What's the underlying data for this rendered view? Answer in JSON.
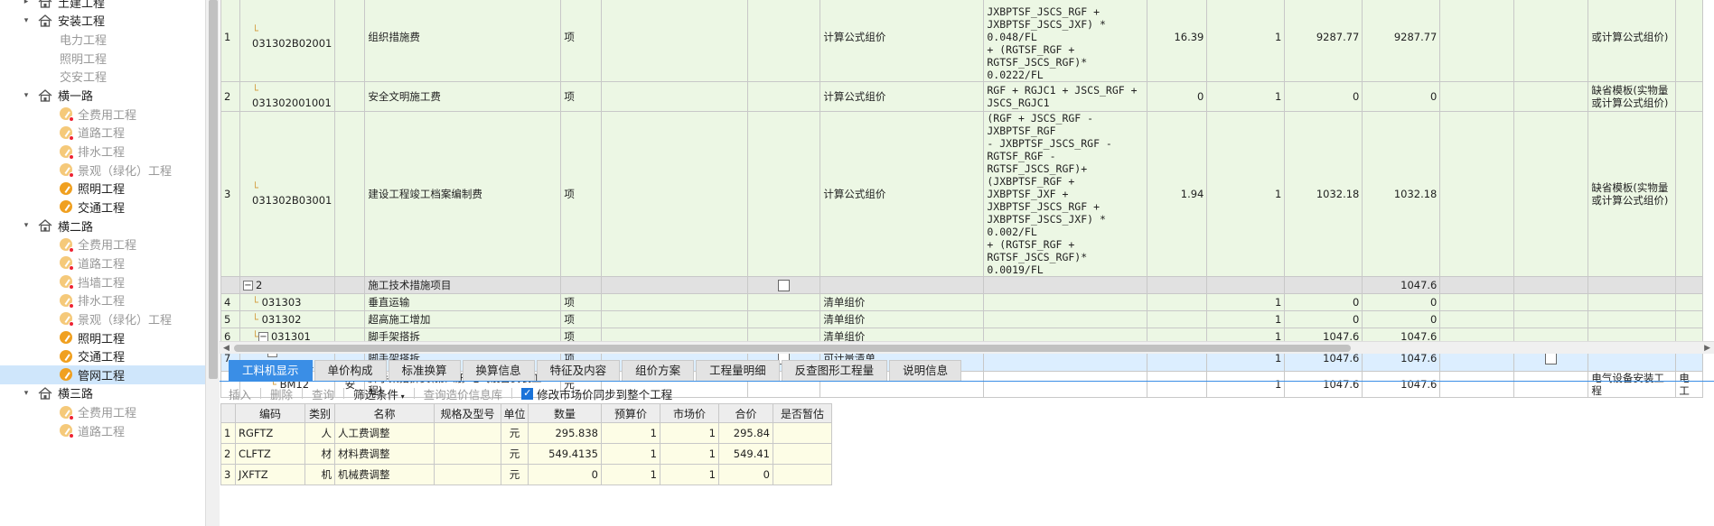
{
  "tree": [
    {
      "kind": "group",
      "label": "土建工程",
      "expanded": false
    },
    {
      "kind": "group",
      "label": "安装工程",
      "expanded": true
    },
    {
      "kind": "item",
      "label": "电力工程",
      "state": "plain"
    },
    {
      "kind": "item",
      "label": "照明工程",
      "state": "plain"
    },
    {
      "kind": "item",
      "label": "交安工程",
      "state": "plain"
    },
    {
      "kind": "group",
      "label": "横一路",
      "expanded": true
    },
    {
      "kind": "item",
      "label": "全费用工程",
      "state": "dim"
    },
    {
      "kind": "item",
      "label": "道路工程",
      "state": "dim"
    },
    {
      "kind": "item",
      "label": "排水工程",
      "state": "dim"
    },
    {
      "kind": "item",
      "label": "景观（绿化）工程",
      "state": "dim"
    },
    {
      "kind": "item",
      "label": "照明工程",
      "state": "active"
    },
    {
      "kind": "item",
      "label": "交通工程",
      "state": "active"
    },
    {
      "kind": "group",
      "label": "横二路",
      "expanded": true
    },
    {
      "kind": "item",
      "label": "全费用工程",
      "state": "dim"
    },
    {
      "kind": "item",
      "label": "道路工程",
      "state": "dim"
    },
    {
      "kind": "item",
      "label": "挡墙工程",
      "state": "dim"
    },
    {
      "kind": "item",
      "label": "排水工程",
      "state": "dim"
    },
    {
      "kind": "item",
      "label": "景观（绿化）工程",
      "state": "dim"
    },
    {
      "kind": "item",
      "label": "照明工程",
      "state": "active"
    },
    {
      "kind": "item",
      "label": "交通工程",
      "state": "active"
    },
    {
      "kind": "item",
      "label": "管网工程",
      "state": "active",
      "selected": true
    },
    {
      "kind": "group",
      "label": "横三路",
      "expanded": true
    },
    {
      "kind": "item",
      "label": "全费用工程",
      "state": "dim"
    },
    {
      "kind": "item",
      "label": "道路工程",
      "state": "dim"
    }
  ],
  "main_rows": [
    {
      "style": "green",
      "h": 71,
      "idx": "1",
      "code": "031302B02001",
      "lvl": 1,
      "type": "",
      "name": "组织措施费",
      "unit": "项",
      "check": false,
      "method": "计算公式组价",
      "formula": "                    \nJXBPTSF_JSCS_RGF +\nJXBPTSF_JSCS_JXF) * 0.048/FL\n+ (RGTSF_RGF +\nRGTSF_JSCS_RGF)* 0.0222/FL",
      "rate": "16.39",
      "qty": "1",
      "price": "9287.77",
      "total": "9287.77",
      "c2": false,
      "note": "或计算公式组价)"
    },
    {
      "style": "green",
      "h": 33,
      "idx": "2",
      "code": "031302001001",
      "lvl": 1,
      "type": "",
      "name": "安全文明施工费",
      "unit": "项",
      "check": false,
      "method": "计算公式组价",
      "formula": "RGF + RGJC1 + JSCS_RGF +\nJSCS_RGJC1",
      "rate": "0",
      "qty": "1",
      "price": "0",
      "total": "0",
      "c2": false,
      "note": "缺省模板(实物量\n或计算公式组价)"
    },
    {
      "style": "green",
      "h": 94,
      "idx": "3",
      "code": "031302B03001",
      "lvl": 1,
      "type": "",
      "name": "建设工程竣工档案编制费",
      "unit": "项",
      "check": false,
      "method": "计算公式组价",
      "formula": "(RGF + JSCS_RGF - JXBPTSF_RGF\n- JXBPTSF_JSCS_RGF -\nRGTSF_RGF - RGTSF_JSCS_RGF)+\n(JXBPTSF_RGF + JXBPTSF_JXF +\nJXBPTSF_JSCS_RGF +\nJXBPTSF_JSCS_JXF) * 0.002/FL\n+ (RGTSF_RGF +\nRGTSF_JSCS_RGF)* 0.0019/FL",
      "rate": "1.94",
      "qty": "1",
      "price": "1032.18",
      "total": "1032.18",
      "c2": false,
      "note": "缺省模板(实物量\n或计算公式组价)"
    },
    {
      "style": "gray",
      "h": 19,
      "idx": "",
      "code": "2",
      "lvl": 0,
      "collapse": true,
      "type": "",
      "name": "施工技术措施项目",
      "unit": "",
      "check": true,
      "method": "",
      "formula": "",
      "rate": "",
      "qty": "",
      "price": "",
      "total": "1047.6",
      "c2": false,
      "note": ""
    },
    {
      "style": "green",
      "h": 19,
      "idx": "4",
      "code": "031303",
      "lvl": 1,
      "type": "",
      "name": "垂直运输",
      "unit": "项",
      "check": false,
      "method": "清单组价",
      "formula": "",
      "rate": "",
      "qty": "1",
      "price": "0",
      "total": "0",
      "c2": false,
      "note": ""
    },
    {
      "style": "green",
      "h": 19,
      "idx": "5",
      "code": "031302",
      "lvl": 1,
      "type": "",
      "name": "超高施工增加",
      "unit": "项",
      "check": false,
      "method": "清单组价",
      "formula": "",
      "rate": "",
      "qty": "1",
      "price": "0",
      "total": "0",
      "c2": false,
      "note": ""
    },
    {
      "style": "green",
      "h": 19,
      "idx": "6",
      "code": "031301",
      "lvl": 1,
      "collapse": true,
      "type": "",
      "name": "脚手架搭拆",
      "unit": "项",
      "check": false,
      "method": "清单组价",
      "formula": "",
      "rate": "",
      "qty": "1",
      "price": "1047.6",
      "total": "1047.6",
      "c2": false,
      "note": ""
    },
    {
      "style": "blue",
      "h": 19,
      "idx": "7",
      "code": "031301017…",
      "lvl": 2,
      "collapse": true,
      "type": "",
      "name": "脚手架搭拆",
      "unit": "项",
      "check": true,
      "method": "可计量清单",
      "formula": "",
      "rate": "",
      "qty": "1",
      "price": "1047.6",
      "total": "1047.6",
      "c2": true,
      "note": ""
    },
    {
      "style": "white",
      "h": 28,
      "idx": "",
      "code": "BM12",
      "lvl": 3,
      "type": "安",
      "name": "脚手架搭拆费(第四册 电气设备安装工\n程)",
      "unit": "元",
      "check": false,
      "method": "",
      "formula": "",
      "rate": "",
      "qty": "1",
      "price": "1047.6",
      "total": "1047.6",
      "c2": false,
      "note": "电气设备安装工\n程",
      "extra": "电\n工"
    }
  ],
  "tabs": [
    "工料机显示",
    "单价构成",
    "标准换算",
    "换算信息",
    "特征及内容",
    "组价方案",
    "工程量明细",
    "反查图形工程量",
    "说明信息"
  ],
  "active_tab": 0,
  "toolbar": {
    "insert": "插入",
    "delete": "删除",
    "query": "查询",
    "filter": "筛选条件",
    "query_db": "查询造价信息库",
    "sync_label": "修改市场价同步到整个工程"
  },
  "sub_headers": [
    "编码",
    "类别",
    "名称",
    "规格及型号",
    "单位",
    "数量",
    "预算价",
    "市场价",
    "合价",
    "是否暂估"
  ],
  "sub_rows": [
    {
      "idx": "1",
      "code": "RGFTZ",
      "cat": "人",
      "name": "人工费调整",
      "spec": "",
      "unit": "元",
      "qty": "295.838",
      "budget": "1",
      "market": "1",
      "total": "295.84",
      "est": ""
    },
    {
      "idx": "2",
      "code": "CLFTZ",
      "cat": "材",
      "name": "材料费调整",
      "spec": "",
      "unit": "元",
      "qty": "549.4135",
      "budget": "1",
      "market": "1",
      "total": "549.41",
      "est": ""
    },
    {
      "idx": "3",
      "code": "JXFTZ",
      "cat": "机",
      "name": "机械费调整",
      "spec": "",
      "unit": "元",
      "qty": "0",
      "budget": "1",
      "market": "1",
      "total": "0",
      "est": ""
    }
  ]
}
